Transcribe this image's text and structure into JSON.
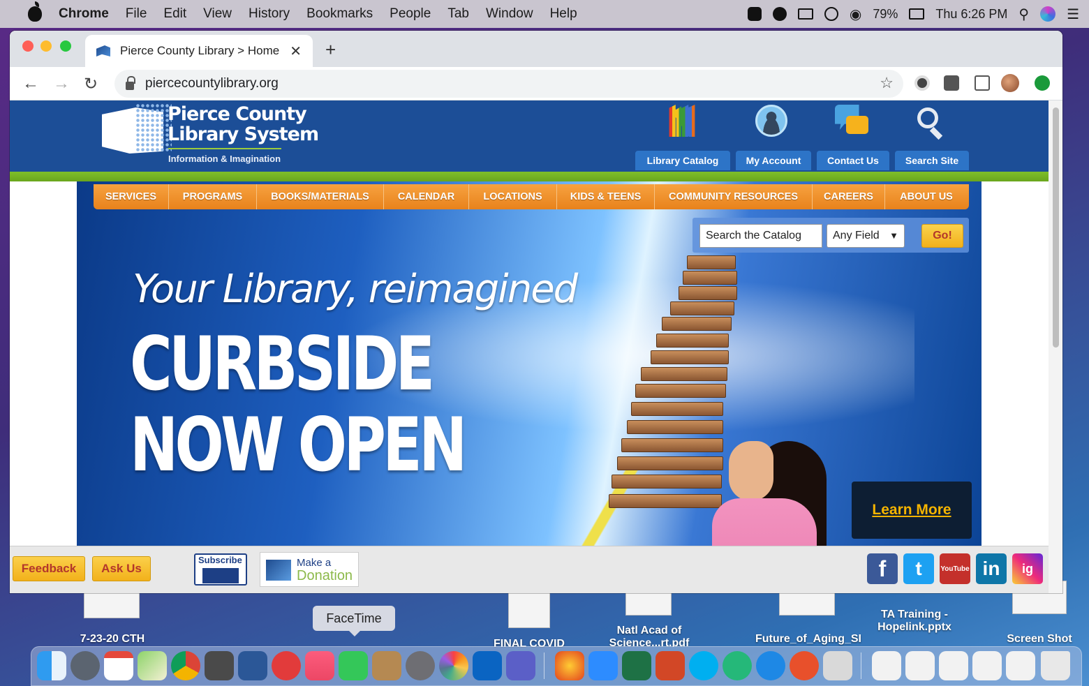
{
  "menubar": {
    "app": "Chrome",
    "items": [
      "File",
      "Edit",
      "View",
      "History",
      "Bookmarks",
      "People",
      "Tab",
      "Window",
      "Help"
    ],
    "battery": "79%",
    "clock": "Thu 6:26 PM"
  },
  "browser": {
    "tab_title": "Pierce County Library > Home",
    "url": "piercecountylibrary.org"
  },
  "site": {
    "logo_line1": "Pierce County",
    "logo_line2": "Library System",
    "logo_tagline": "Information & Imagination",
    "quick_links": [
      "Library Catalog",
      "My Account",
      "Contact Us",
      "Search Site"
    ],
    "nav": [
      "SERVICES",
      "PROGRAMS",
      "BOOKS/MATERIALS",
      "CALENDAR",
      "LOCATIONS",
      "KIDS & TEENS",
      "COMMUNITY RESOURCES",
      "CAREERS",
      "ABOUT US"
    ],
    "search": {
      "placeholder": "Search the Catalog",
      "field_selected": "Any Field",
      "go_label": "Go!"
    },
    "banner": {
      "tagline": "Your Library, reimagined",
      "headline_1": "CURBSIDE",
      "headline_2": "NOW OPEN",
      "cta": "Learn More"
    },
    "footer": {
      "feedback": "Feedback",
      "ask_us": "Ask Us",
      "subscribe": "Subscribe",
      "donation_line1": "Make a",
      "donation_line2": "Donation",
      "social": [
        "f",
        "t",
        "YouTube",
        "in",
        "ig"
      ]
    },
    "colors": {
      "header_blue": "#1c4e97",
      "nav_orange": "#e8821c",
      "accent_green": "#7fbf2b",
      "button_yellow": "#f2b11b"
    }
  },
  "desktop": {
    "tooltip": "FaceTime",
    "files": [
      "7-23-20 CTH",
      "FINAL COVID",
      "Natl Acad of Science...rt.pdf",
      "Future_of_Aging_SI",
      "TA Training - Hopelink.pptx",
      "Screen Shot"
    ]
  }
}
